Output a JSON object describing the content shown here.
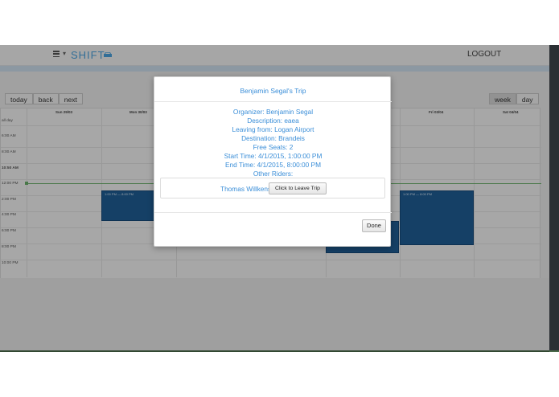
{
  "navbar": {
    "brand": "SHIFT",
    "logout_label": "LOGOUT",
    "icons": [
      "menu-icon",
      "car-icon"
    ]
  },
  "calendar": {
    "nav_buttons": [
      "today",
      "back",
      "next"
    ],
    "view_buttons": [
      "week",
      "day"
    ],
    "active_view": "week",
    "day_headers": [
      "Sun 29/03",
      "Mon 30/03",
      "Fri 03/04",
      "Sat 04/04"
    ],
    "all_day_label": "all day",
    "time_labels": [
      "6:00 AM",
      "8:00 AM",
      "10:50 AM",
      "12:00 PM",
      "2:00 PM",
      "4:00 PM",
      "6:00 PM",
      "8:00 PM",
      "10:00 PM"
    ],
    "events": [
      {
        "label": "1:00 PM — 8:00 PM"
      },
      {
        "label": "1:00 PM — 8:00 PM"
      },
      {
        "label": ""
      }
    ],
    "colors": {
      "event": "#1f5f97",
      "now_line": "#6cb26c"
    }
  },
  "modal": {
    "title": "Benjamin Segal's Trip",
    "organizer": "Organizer: Benjamin Segal",
    "description": "Description: eaea",
    "leaving_from": "Leaving from: Logan Airport",
    "destination": "Destination: Brandeis",
    "free_seats": "Free Seats: 2",
    "start_time": "Start Time: 4/1/2015, 1:00:00 PM",
    "end_time": "End Time: 4/1/2015, 8:00:00 PM",
    "other_riders_label": "Other Riders:",
    "riders": [
      {
        "name": "Thomas Willkens",
        "action_label": "Click to Leave Trip"
      }
    ],
    "done_label": "Done",
    "accent_color": "#3a8ed8"
  }
}
